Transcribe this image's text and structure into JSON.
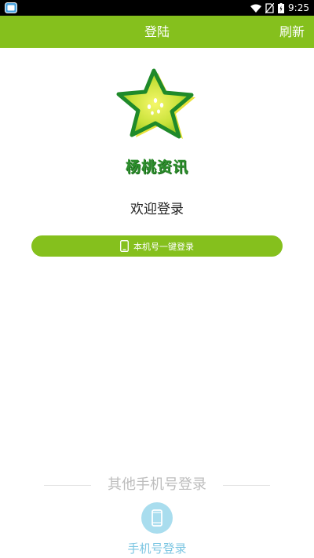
{
  "status_bar": {
    "time": "9:25"
  },
  "header": {
    "title": "登陆",
    "refresh_label": "刷新"
  },
  "logo": {
    "text": "杨桃资讯"
  },
  "welcome": "欢迎登录",
  "one_click_login": {
    "label": "本机号一键登录"
  },
  "other_login": {
    "divider_label": "其他手机号登录",
    "phone_login_label": "手机号登录"
  },
  "colors": {
    "brand_green": "#85c01d",
    "light_blue": "#a9ddee",
    "link_blue": "#7cc6e2"
  }
}
